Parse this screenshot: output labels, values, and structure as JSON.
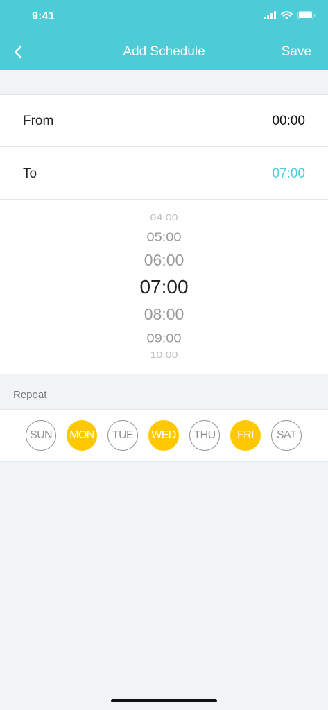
{
  "status_bar": {
    "time": "9:41"
  },
  "nav": {
    "title": "Add Schedule",
    "save_label": "Save",
    "back_icon": "chevron-left-icon"
  },
  "schedule": {
    "from_label": "From",
    "from_value": "00:00",
    "to_label": "To",
    "to_value": "07:00"
  },
  "picker": {
    "items": [
      "04:00",
      "05:00",
      "06:00",
      "07:00",
      "08:00",
      "09:00",
      "10:00"
    ],
    "selected_index": 3
  },
  "repeat": {
    "label": "Repeat",
    "days": [
      {
        "label": "SUN",
        "selected": false
      },
      {
        "label": "MON",
        "selected": true
      },
      {
        "label": "TUE",
        "selected": false
      },
      {
        "label": "WED",
        "selected": true
      },
      {
        "label": "THU",
        "selected": false
      },
      {
        "label": "FRI",
        "selected": true
      },
      {
        "label": "SAT",
        "selected": false
      }
    ]
  },
  "colors": {
    "accent": "#4dcbd7",
    "day_selected": "#ffc800",
    "background": "#f1f4f7"
  }
}
